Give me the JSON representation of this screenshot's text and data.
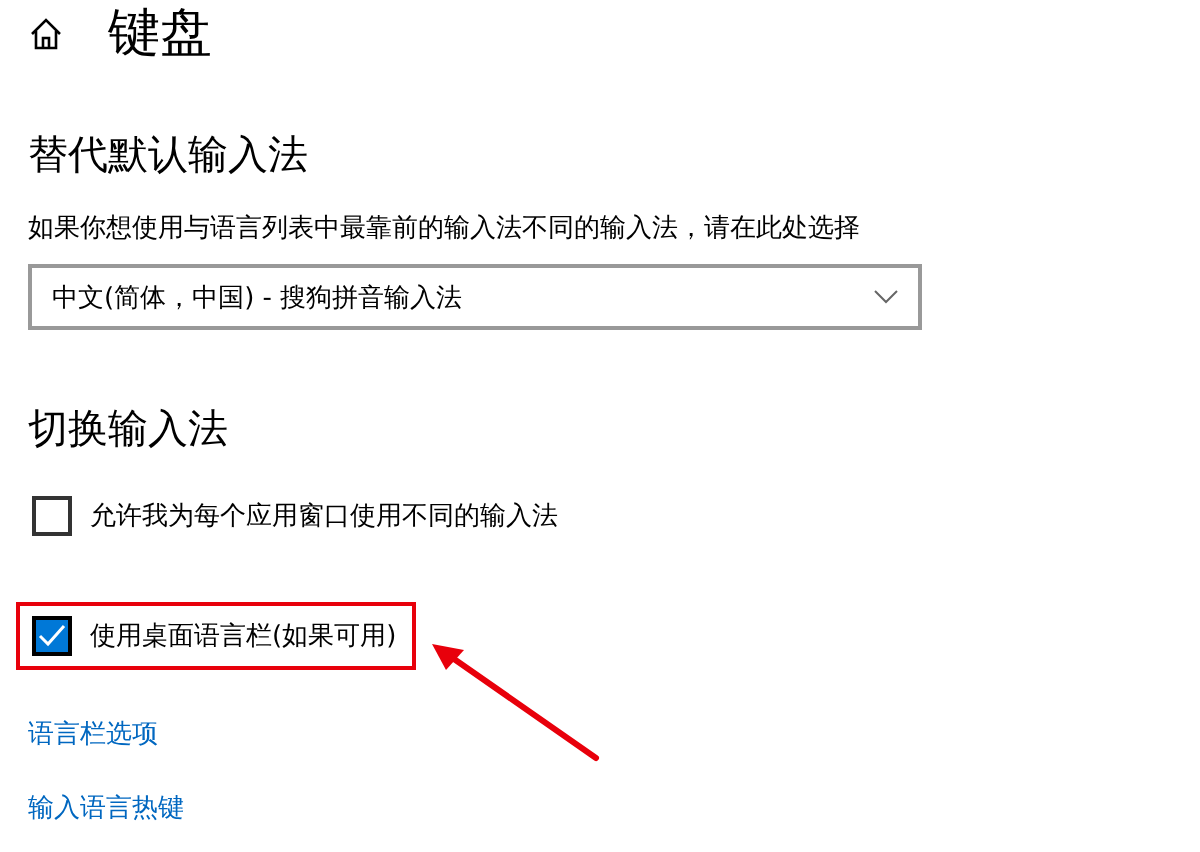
{
  "page": {
    "title": "键盘"
  },
  "default_input": {
    "heading": "替代默认输入法",
    "description": "如果你想使用与语言列表中最靠前的输入法不同的输入法，请在此处选择",
    "dropdown": {
      "value": "中文(简体，中国) - 搜狗拼音输入法"
    }
  },
  "switching": {
    "heading": "切换输入法",
    "options": [
      {
        "label": "允许我为每个应用窗口使用不同的输入法",
        "checked": false,
        "highlighted": false
      },
      {
        "label": "使用桌面语言栏(如果可用)",
        "checked": true,
        "highlighted": true
      }
    ]
  },
  "links": [
    "语言栏选项",
    "输入语言热键"
  ]
}
